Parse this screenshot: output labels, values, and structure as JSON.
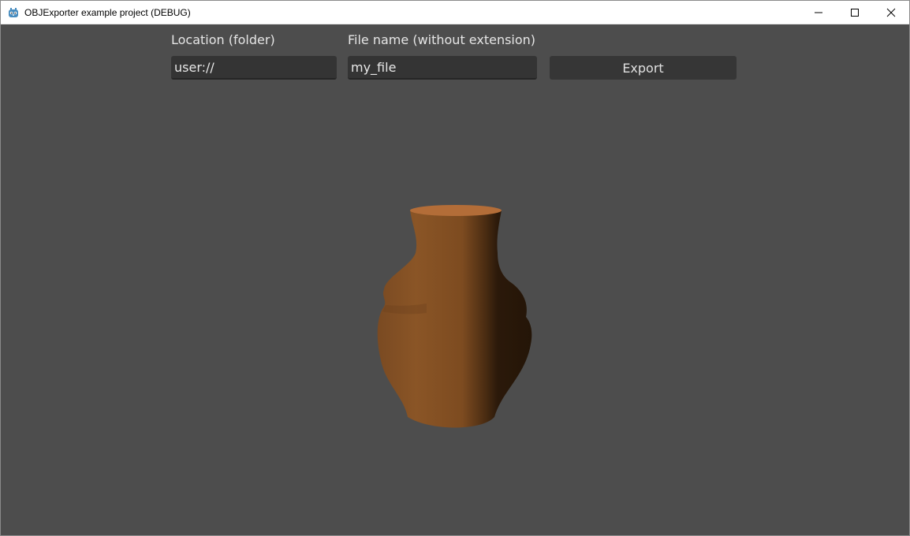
{
  "window": {
    "title": "OBJExporter example project (DEBUG)",
    "icon": "godot-icon",
    "controls": [
      "minimize-icon",
      "maximize-icon",
      "close-icon"
    ]
  },
  "form": {
    "location_label": "Location (folder)",
    "location_value": "user://",
    "filename_label": "File name (without extension)",
    "filename_value": "my_file",
    "export_label": "Export"
  },
  "scene": {
    "background_color": "#4d4d4d",
    "object": "vase",
    "object_color": "#8a5526"
  }
}
